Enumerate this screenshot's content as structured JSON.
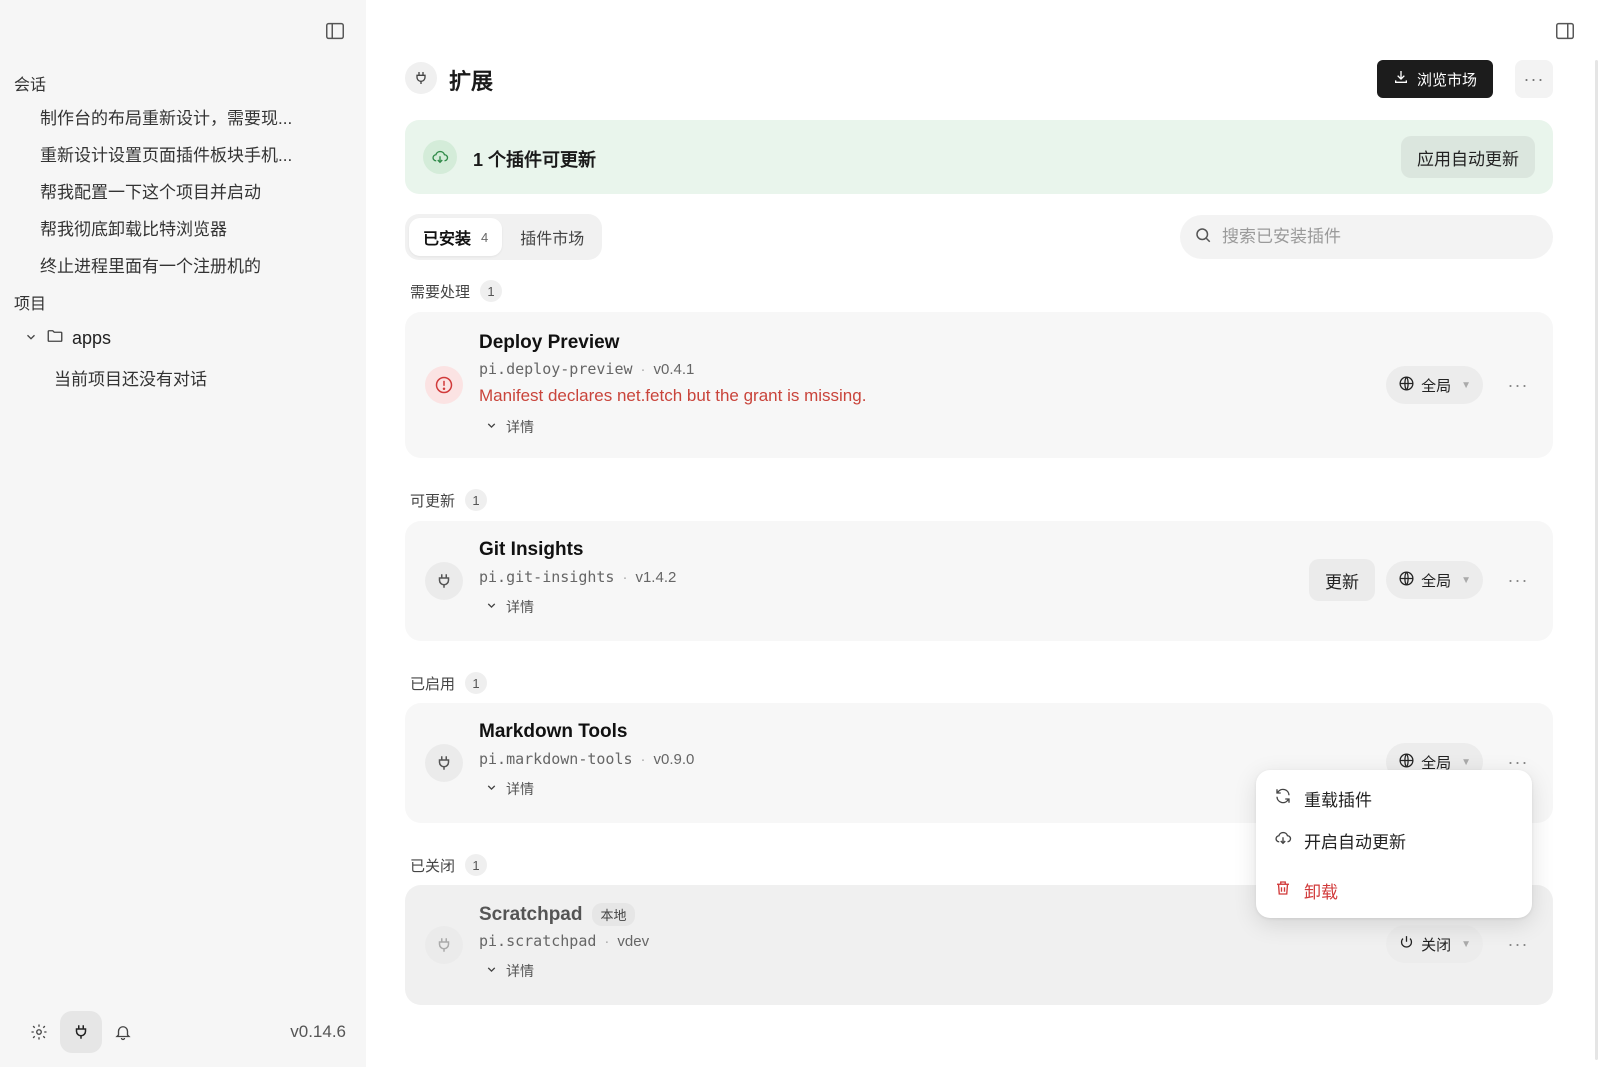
{
  "sidebar": {
    "sessions_label": "会话",
    "sessions": [
      "制作台的布局重新设计，需要现...",
      "重新设计设置页面插件板块手机...",
      "帮我配置一下这个项目并启动",
      "帮我彻底卸载比特浏览器",
      "终止进程里面有一个注册机的"
    ],
    "projects_label": "项目",
    "project_folder": "apps",
    "project_empty": "当前项目还没有对话",
    "version": "v0.14.6"
  },
  "header": {
    "title": "扩展",
    "browse_button": "浏览市场",
    "more": "···"
  },
  "banner": {
    "text": "1 个插件可更新",
    "button": "应用自动更新"
  },
  "tabs": [
    {
      "label": "已安装",
      "count": "4"
    },
    {
      "label": "插件市场"
    }
  ],
  "search": {
    "placeholder": "搜索已安装插件"
  },
  "sections": {
    "attention": {
      "label": "需要处理",
      "count": "1"
    },
    "updatable": {
      "label": "可更新",
      "count": "1"
    },
    "enabled": {
      "label": "已启用",
      "count": "1"
    },
    "disabled": {
      "label": "已关闭",
      "count": "1"
    }
  },
  "plugins": {
    "deploy": {
      "name": "Deploy Preview",
      "id": "pi.deploy-preview",
      "version": "v0.4.1",
      "error": "Manifest declares net.fetch but the grant is missing.",
      "details": "详情",
      "scope": "全局"
    },
    "git": {
      "name": "Git Insights",
      "id": "pi.git-insights",
      "version": "v1.4.2",
      "details": "详情",
      "update": "更新",
      "scope": "全局"
    },
    "markdown": {
      "name": "Markdown Tools",
      "id": "pi.markdown-tools",
      "version": "v0.9.0",
      "details": "详情",
      "scope": "全局"
    },
    "scratch": {
      "name": "Scratchpad",
      "badge": "本地",
      "id": "pi.scratchpad",
      "version": "vdev",
      "details": "详情",
      "scope": "关闭"
    }
  },
  "context_menu": {
    "reload": "重载插件",
    "auto_update": "开启自动更新",
    "uninstall": "卸载"
  },
  "dot_separator": "·",
  "more_glyph": "···",
  "colors": {
    "accent_dark": "#1c1c1c",
    "banner_bg": "#e9f5ec",
    "success": "#2f8a48",
    "error": "#d13a3a"
  }
}
